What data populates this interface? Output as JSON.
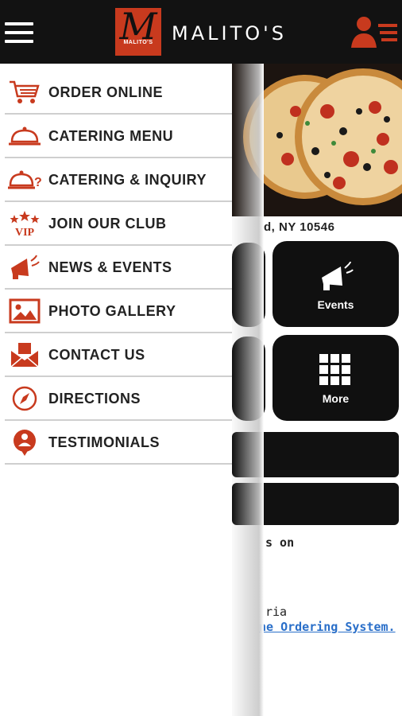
{
  "header": {
    "brand_name": "MALITO'S",
    "logo_letter": "M",
    "logo_caption": "MALITO'S",
    "menu_icon": "hamburger-menu-icon",
    "account_icon": "user-list-icon"
  },
  "colors": {
    "header_bg": "#121212",
    "accent": "#c83a1e",
    "tile_bg": "#101010",
    "link": "#2a6fc9"
  },
  "drawer": {
    "items": [
      {
        "label": "ORDER ONLINE",
        "icon": "shopping-cart-icon"
      },
      {
        "label": "CATERING MENU",
        "icon": "cloche-icon"
      },
      {
        "label": "CATERING & INQUIRY",
        "icon": "cloche-question-icon"
      },
      {
        "label": "JOIN OUR CLUB",
        "icon": "vip-stars-icon"
      },
      {
        "label": "NEWS & EVENTS",
        "icon": "megaphone-icon"
      },
      {
        "label": "PHOTO GALLERY",
        "icon": "picture-icon"
      },
      {
        "label": "CONTACT US",
        "icon": "envelope-icon"
      },
      {
        "label": "DIRECTIONS",
        "icon": "compass-icon"
      },
      {
        "label": "TESTIMONIALS",
        "icon": "chat-bubble-icon"
      }
    ]
  },
  "background": {
    "address": "d, NY 10546",
    "tiles": [
      {
        "label": "Events",
        "icon": "megaphone-icon"
      },
      {
        "label": "More",
        "icon": "grid-icon"
      }
    ],
    "text_line_1": "s on",
    "text_line_2": "ria",
    "link_text": "ne Ordering System."
  }
}
